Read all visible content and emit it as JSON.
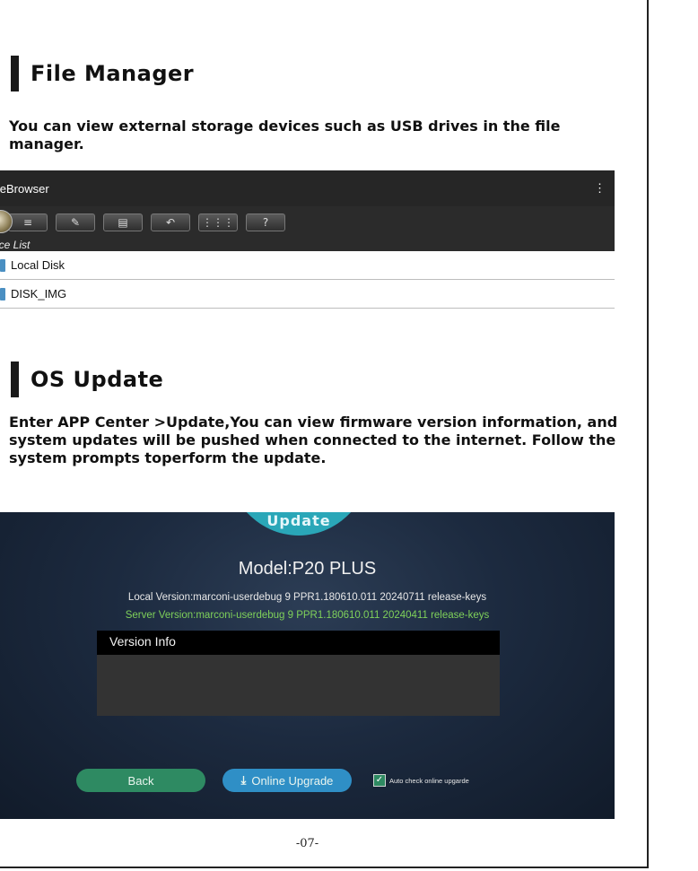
{
  "sections": {
    "file_manager": {
      "title": "File Manager",
      "text": "You can view external storage devices such as USB drives in the file manager."
    },
    "os_update": {
      "title": "OS Update",
      "text": "Enter APP Center >Update,You can view firmware version information, and system updates will be pushed when connected to the internet. Follow the system prompts toperform the update."
    }
  },
  "file_browser": {
    "app_title": "ileBrowser",
    "overflow_menu": "⋮",
    "toolbar_icons": [
      "list-icon",
      "edit-icon",
      "details-icon",
      "undo-icon",
      "grid-icon",
      "help-icon"
    ],
    "list_header": "ice List",
    "rows": [
      "Local Disk",
      "DISK_IMG"
    ]
  },
  "update_screen": {
    "dial_label": "Update",
    "model": "Model:P20 PLUS",
    "local_version": "Local Version:marconi-userdebug 9 PPR1.180610.011 20240711 release-keys",
    "server_version": "Server Version:marconi-userdebug 9 PPR1.180610.011 20240411 release-keys",
    "version_info_label": "Version Info",
    "back_label": "Back",
    "online_upgrade_label": "Online Upgrade",
    "auto_check_label": "Auto check online upgarde",
    "colors": {
      "accent_teal": "#2aa7b8",
      "back_green": "#2e8a62",
      "upgrade_blue": "#2f8fc6",
      "server_green": "#7fd15a"
    }
  },
  "page_number": "-07-"
}
